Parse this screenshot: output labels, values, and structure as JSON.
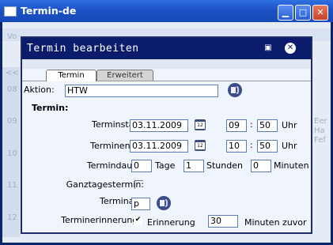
{
  "window": {
    "title": "Termin-de"
  },
  "background": {
    "top_left": "Vo",
    "rows": [
      "<<",
      "08",
      "09",
      "10",
      "11",
      "12"
    ],
    "right_text": [
      "Eer",
      "Ha",
      "Fef"
    ]
  },
  "dialog": {
    "title": "Termin bearbeiten",
    "tabs": [
      {
        "label": "Termin"
      },
      {
        "label": "Erweitert"
      }
    ]
  },
  "form": {
    "aktion_label": "Aktion:",
    "aktion_value": "HTW",
    "section_label": "Termin:",
    "start_label": "Terminstart:",
    "start_date": "03.11.2009",
    "start_hour": "09",
    "start_min": "50",
    "end_label": "Terminende:",
    "end_date": "03.11.2009",
    "end_hour": "10",
    "end_min": "50",
    "uhr": "Uhr",
    "time_sep": ":",
    "dauer_label": "Termindauer:",
    "dauer_tage": "0",
    "tage_label": "Tage",
    "dauer_stunden": "1",
    "stunden_label": "Stunden",
    "dauer_minuten": "0",
    "minuten_label": "Minuten",
    "ganztag_label": "Ganztagestermin:",
    "art_label": "Terminart:",
    "art_value": "p",
    "erinnerung_label": "Terminerinnerung:",
    "erinnerung_check": "✔",
    "erinnerung_text": "Erinnerung",
    "erinnerung_value": "30",
    "erinnerung_suffix": "Minuten zuvor",
    "calendar_glyph": "12"
  }
}
